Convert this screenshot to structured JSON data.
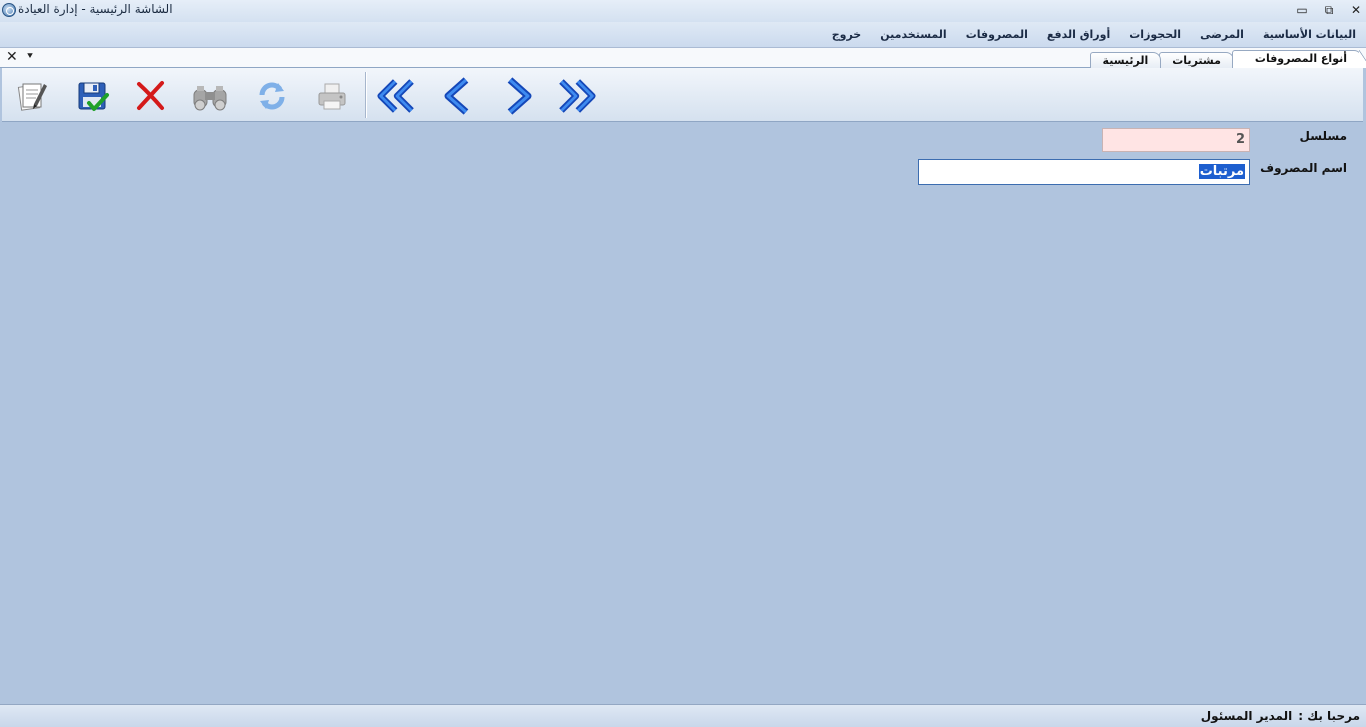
{
  "window": {
    "title": "الشاشة الرئيسية - إدارة العيادة",
    "minimize_glyph": "▭",
    "restore_glyph": "⧉",
    "close_glyph": "✕"
  },
  "menu": {
    "items": [
      {
        "label": "البيانات الأساسية"
      },
      {
        "label": "المرضى"
      },
      {
        "label": "الحجوزات"
      },
      {
        "label": "أوراق الدفع"
      },
      {
        "label": "المصروفات"
      },
      {
        "label": "المستخدمين"
      },
      {
        "label": "خروج"
      }
    ]
  },
  "mdi": {
    "close_glyph": "✕",
    "menu_glyph": "⯆",
    "tabs": [
      {
        "label": "أنواع المصروفات",
        "active": true
      },
      {
        "label": "مشتريات",
        "active": false
      },
      {
        "label": "الرئيسية",
        "active": false
      }
    ]
  },
  "toolbar": {
    "buttons": [
      {
        "icon": "new-document-icon",
        "enabled": true
      },
      {
        "icon": "save-icon",
        "enabled": true
      },
      {
        "icon": "delete-icon",
        "enabled": true
      },
      {
        "icon": "search-binoculars-icon",
        "enabled": false
      },
      {
        "icon": "refresh-icon",
        "enabled": false
      },
      {
        "icon": "print-icon",
        "enabled": false
      },
      {
        "icon": "first-record-icon",
        "enabled": true
      },
      {
        "icon": "previous-record-icon",
        "enabled": true
      },
      {
        "icon": "next-record-icon",
        "enabled": true
      },
      {
        "icon": "last-record-icon",
        "enabled": true
      }
    ]
  },
  "form": {
    "serial_label": "مسلسل",
    "serial_value": "2",
    "expense_name_label": "اسم المصروف",
    "expense_name_value": "مرتبات"
  },
  "status": {
    "welcome_label": "مرحبا بك :",
    "user_name": "المدير المسئول"
  },
  "colors": {
    "background": "#b0c4de",
    "serial_field_bg": "#ffe4e4",
    "selection": "#1e5fcf",
    "nav_arrow": "#1e6fe0",
    "delete_red": "#d41a1a"
  }
}
